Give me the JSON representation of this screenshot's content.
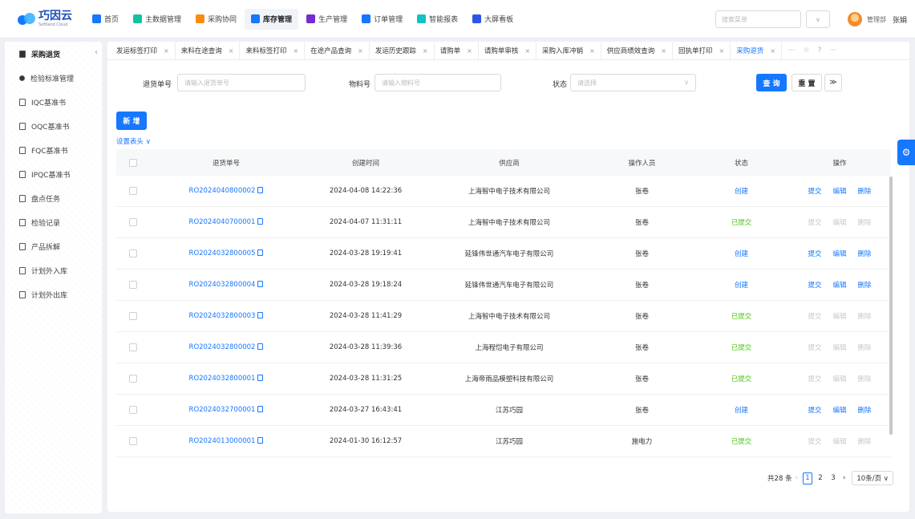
{
  "logo": {
    "name": "巧因云",
    "sub": "Softland Cloud"
  },
  "nav": [
    {
      "label": "首页",
      "icon": "home-icon",
      "color": "#1677ff"
    },
    {
      "label": "主数据管理",
      "icon": "database-icon",
      "color": "#13c2a3"
    },
    {
      "label": "采购协同",
      "icon": "cart-icon",
      "color": "#fa8c16"
    },
    {
      "label": "库存管理",
      "icon": "warehouse-icon",
      "color": "#1677ff",
      "active": true
    },
    {
      "label": "生产管理",
      "icon": "production-icon",
      "color": "#722ed1"
    },
    {
      "label": "订单管理",
      "icon": "order-icon",
      "color": "#1677ff"
    },
    {
      "label": "智能报表",
      "icon": "report-icon",
      "color": "#13c2c2"
    },
    {
      "label": "大屏看板",
      "icon": "dashboard-icon",
      "color": "#2f54eb"
    }
  ],
  "topbar": {
    "search_placeholder": "搜索菜单",
    "select_arrow": "∨",
    "department": "管理部",
    "username": "张娟"
  },
  "sidebar": {
    "items": [
      {
        "label": "采购退货",
        "icon": "folder-icon",
        "active": true
      },
      {
        "label": "检验标准管理",
        "icon": "search-icon"
      },
      {
        "label": "IQC基准书",
        "icon": "document-icon"
      },
      {
        "label": "OQC基准书",
        "icon": "document-icon"
      },
      {
        "label": "FQC基准书",
        "icon": "document-icon"
      },
      {
        "label": "IPQC基准书",
        "icon": "document-icon"
      },
      {
        "label": "盘点任务",
        "icon": "document-icon"
      },
      {
        "label": "检验记录",
        "icon": "document-icon"
      },
      {
        "label": "产品拆解",
        "icon": "document-icon"
      },
      {
        "label": "计划外入库",
        "icon": "document-icon"
      },
      {
        "label": "计划外出库",
        "icon": "document-icon"
      }
    ],
    "collapse": "‹"
  },
  "tabs": [
    {
      "label": "发运标签打印"
    },
    {
      "label": "来料在途查询"
    },
    {
      "label": "来料标签打印"
    },
    {
      "label": "在途产品查询"
    },
    {
      "label": "发运历史跟踪"
    },
    {
      "label": "请购单"
    },
    {
      "label": "请购单审核"
    },
    {
      "label": "采购入库冲销"
    },
    {
      "label": "供应商绩效查询"
    },
    {
      "label": "回执单打印"
    },
    {
      "label": "采购退货",
      "active": true
    }
  ],
  "tab_close": "×",
  "tab_extra": {
    "more": "···",
    "star": "☆",
    "help": "?",
    "overflow": "···"
  },
  "filter": {
    "return_no_label": "退货单号",
    "return_no_placeholder": "请输入退货单号",
    "material_label": "物料号",
    "material_placeholder": "请输入物料号",
    "status_label": "状态",
    "status_placeholder": "请选择",
    "query_btn": "查 询",
    "reset_btn": "重 置",
    "expand_btn": "≫"
  },
  "toolbar": {
    "add_btn": "新 增",
    "set_header": "设置表头 ∨"
  },
  "table": {
    "headers": [
      "退货单号",
      "创建时间",
      "供应商",
      "操作人员",
      "状态",
      "操作"
    ],
    "actions": {
      "submit": "提交",
      "edit": "编辑",
      "delete": "删除"
    },
    "rows": [
      {
        "no": "RO2024040800002",
        "time": "2024-04-08 14:22:36",
        "supplier": "上海智中电子技术有限公司",
        "operator": "张卷",
        "status": "创建",
        "state": "created"
      },
      {
        "no": "RO2024040700001",
        "time": "2024-04-07 11:31:11",
        "supplier": "上海智中电子技术有限公司",
        "operator": "张卷",
        "status": "已提交",
        "state": "submitted"
      },
      {
        "no": "RO2024032800005",
        "time": "2024-03-28 19:19:41",
        "supplier": "延锋伟世通汽车电子有限公司",
        "operator": "张卷",
        "status": "创建",
        "state": "created"
      },
      {
        "no": "RO2024032800004",
        "time": "2024-03-28 19:18:24",
        "supplier": "延锋伟世通汽车电子有限公司",
        "operator": "张卷",
        "status": "创建",
        "state": "created"
      },
      {
        "no": "RO2024032800003",
        "time": "2024-03-28 11:41:29",
        "supplier": "上海智中电子技术有限公司",
        "operator": "张卷",
        "status": "已提交",
        "state": "submitted"
      },
      {
        "no": "RO2024032800002",
        "time": "2024-03-28 11:39:36",
        "supplier": "上海程恺电子有限公司",
        "operator": "张卷",
        "status": "已提交",
        "state": "submitted"
      },
      {
        "no": "RO2024032800001",
        "time": "2024-03-28 11:31:25",
        "supplier": "上海帝雨品模塑科技有限公司",
        "operator": "张卷",
        "status": "已提交",
        "state": "submitted"
      },
      {
        "no": "RO2024032700001",
        "time": "2024-03-27 16:43:41",
        "supplier": "江苏巧园",
        "operator": "张卷",
        "status": "创建",
        "state": "created"
      },
      {
        "no": "RO2024013000001",
        "time": "2024-01-30 16:12:57",
        "supplier": "江苏巧园",
        "operator": "施电力",
        "status": "已提交",
        "state": "submitted"
      }
    ]
  },
  "pager": {
    "total": "共28 条",
    "prev": "‹",
    "next": "›",
    "pages": [
      "1",
      "2",
      "3"
    ],
    "current": "1",
    "size": "10条/页 ∨"
  },
  "float_gear": "⚙"
}
